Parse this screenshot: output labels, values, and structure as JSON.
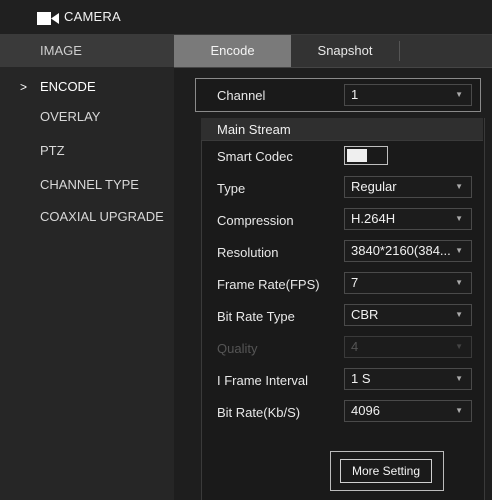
{
  "header": {
    "title": "CAMERA",
    "icon": "camera-icon"
  },
  "sidebar": {
    "items": [
      {
        "label": "IMAGE"
      },
      {
        "label": "ENCODE",
        "active": true
      },
      {
        "label": "OVERLAY"
      },
      {
        "label": "PTZ"
      },
      {
        "label": "CHANNEL TYPE"
      },
      {
        "label": "COAXIAL UPGRADE"
      }
    ],
    "active_marker": ">"
  },
  "tabs": [
    {
      "label": "Encode",
      "active": true
    },
    {
      "label": "Snapshot"
    }
  ],
  "channel": {
    "label": "Channel",
    "value": "1"
  },
  "main_stream": {
    "title": "Main Stream",
    "smart_codec": {
      "label": "Smart Codec",
      "enabled": false
    },
    "type": {
      "label": "Type",
      "value": "Regular"
    },
    "compression": {
      "label": "Compression",
      "value": "H.264H"
    },
    "resolution": {
      "label": "Resolution",
      "value": "3840*2160(384..."
    },
    "frame_rate": {
      "label": "Frame Rate(FPS)",
      "value": "7"
    },
    "bit_rate_type": {
      "label": "Bit Rate Type",
      "value": "CBR"
    },
    "quality": {
      "label": "Quality",
      "value": "4",
      "disabled": true
    },
    "iframe_interval": {
      "label": "I Frame Interval",
      "value": "1 S"
    },
    "bit_rate": {
      "label": "Bit Rate(Kb/S)",
      "value": "4096"
    }
  },
  "more_setting_label": "More Setting",
  "colors": {
    "background": "#2b2b2b",
    "active_tab": "#7a7a7a",
    "panel": "#1a1a1a"
  }
}
